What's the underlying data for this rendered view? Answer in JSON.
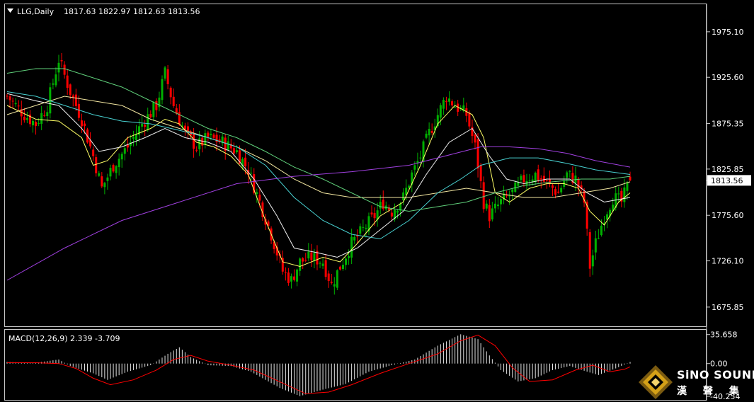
{
  "header": {
    "symbol": "LLG,Daily",
    "ohlc": "1817.63 1822.97 1812.63 1813.56"
  },
  "macd_panel": {
    "label": "MACD(12,26,9) 2.339 -3.709"
  },
  "logo": {
    "brand": "SiNO SOUND",
    "chinese": "漢 聲 集 團"
  },
  "colors": {
    "background": "#000000",
    "frame": "#c8c8c8",
    "bull_candle": "#00b000",
    "bear_candle": "#ff0000",
    "price_tag_bg": "#ffffff",
    "ma_yellow": "#ffff66",
    "ma_khaki": "#f2e6a0",
    "ma_white": "#f0f0f0",
    "ma_cyan": "#48d1d1",
    "ma_green": "#5fcf7a",
    "ma_purple": "#a040e0",
    "macd_hist": "#e6e6e6",
    "macd_signal": "#ff0000",
    "logo_gold": "#d4a017"
  },
  "chart_data": [
    {
      "type": "candlestick",
      "title": "LLG,Daily",
      "ylim": [
        1655,
        2005
      ],
      "yticks": [
        1675.85,
        1726.1,
        1775.6,
        1825.85,
        1875.35,
        1925.6,
        1975.1
      ],
      "ytick_labels": [
        "1675.85",
        "1726.10",
        "1775.60",
        "1825.85",
        "1875.35",
        "1925.60",
        "1975.10"
      ],
      "current_price": 1813.56,
      "current_price_label": "1813.56",
      "last_bar": {
        "open": 1817.63,
        "high": 1822.97,
        "low": 1812.63,
        "close": 1813.56
      },
      "close_path": [
        [
          0,
          1905
        ],
        [
          6,
          1885
        ],
        [
          10,
          1875
        ],
        [
          14,
          1895
        ],
        [
          18,
          1945
        ],
        [
          22,
          1910
        ],
        [
          26,
          1880
        ],
        [
          30,
          1840
        ],
        [
          33,
          1805
        ],
        [
          37,
          1830
        ],
        [
          42,
          1850
        ],
        [
          47,
          1875
        ],
        [
          52,
          1895
        ],
        [
          55,
          1930
        ],
        [
          58,
          1895
        ],
        [
          62,
          1865
        ],
        [
          66,
          1850
        ],
        [
          70,
          1860
        ],
        [
          75,
          1855
        ],
        [
          80,
          1845
        ],
        [
          84,
          1825
        ],
        [
          88,
          1790
        ],
        [
          92,
          1755
        ],
        [
          96,
          1715
        ],
        [
          99,
          1705
        ],
        [
          102,
          1725
        ],
        [
          106,
          1730
        ],
        [
          110,
          1725
        ],
        [
          113,
          1700
        ],
        [
          116,
          1720
        ],
        [
          120,
          1745
        ],
        [
          124,
          1760
        ],
        [
          128,
          1775
        ],
        [
          131,
          1790
        ],
        [
          134,
          1780
        ],
        [
          138,
          1795
        ],
        [
          141,
          1820
        ],
        [
          144,
          1840
        ],
        [
          147,
          1865
        ],
        [
          150,
          1885
        ],
        [
          153,
          1905
        ],
        [
          156,
          1895
        ],
        [
          160,
          1885
        ],
        [
          163,
          1850
        ],
        [
          166,
          1790
        ],
        [
          168,
          1775
        ],
        [
          172,
          1790
        ],
        [
          176,
          1800
        ],
        [
          180,
          1815
        ],
        [
          184,
          1820
        ],
        [
          188,
          1810
        ],
        [
          192,
          1800
        ],
        [
          195,
          1820
        ],
        [
          198,
          1815
        ],
        [
          201,
          1790
        ],
        [
          203,
          1720
        ],
        [
          205,
          1745
        ],
        [
          208,
          1775
        ],
        [
          211,
          1795
        ],
        [
          214,
          1790
        ],
        [
          217,
          1814
        ]
      ],
      "moving_averages": [
        {
          "color_key": "ma_yellow",
          "points": [
            [
              0,
              1895
            ],
            [
              10,
              1880
            ],
            [
              18,
              1878
            ],
            [
              26,
              1860
            ],
            [
              30,
              1830
            ],
            [
              35,
              1835
            ],
            [
              42,
              1860
            ],
            [
              50,
              1870
            ],
            [
              55,
              1880
            ],
            [
              60,
              1875
            ],
            [
              66,
              1855
            ],
            [
              72,
              1850
            ],
            [
              78,
              1840
            ],
            [
              84,
              1820
            ],
            [
              90,
              1770
            ],
            [
              96,
              1725
            ],
            [
              102,
              1720
            ],
            [
              110,
              1730
            ],
            [
              116,
              1725
            ],
            [
              122,
              1745
            ],
            [
              130,
              1775
            ],
            [
              138,
              1790
            ],
            [
              144,
              1830
            ],
            [
              150,
              1875
            ],
            [
              156,
              1895
            ],
            [
              162,
              1885
            ],
            [
              166,
              1860
            ],
            [
              170,
              1800
            ],
            [
              175,
              1790
            ],
            [
              182,
              1805
            ],
            [
              188,
              1810
            ],
            [
              194,
              1810
            ],
            [
              199,
              1805
            ],
            [
              203,
              1780
            ],
            [
              208,
              1765
            ],
            [
              213,
              1790
            ],
            [
              217,
              1800
            ]
          ]
        },
        {
          "color_key": "ma_white",
          "points": [
            [
              0,
              1908
            ],
            [
              10,
              1900
            ],
            [
              18,
              1895
            ],
            [
              26,
              1870
            ],
            [
              32,
              1845
            ],
            [
              40,
              1850
            ],
            [
              48,
              1860
            ],
            [
              55,
              1870
            ],
            [
              62,
              1860
            ],
            [
              70,
              1855
            ],
            [
              78,
              1845
            ],
            [
              86,
              1815
            ],
            [
              94,
              1775
            ],
            [
              100,
              1740
            ],
            [
              108,
              1735
            ],
            [
              115,
              1730
            ],
            [
              122,
              1740
            ],
            [
              130,
              1760
            ],
            [
              138,
              1780
            ],
            [
              146,
              1820
            ],
            [
              154,
              1855
            ],
            [
              162,
              1870
            ],
            [
              168,
              1840
            ],
            [
              174,
              1815
            ],
            [
              180,
              1810
            ],
            [
              188,
              1815
            ],
            [
              196,
              1815
            ],
            [
              202,
              1800
            ],
            [
              208,
              1790
            ],
            [
              217,
              1795
            ]
          ]
        },
        {
          "color_key": "ma_khaki",
          "points": [
            [
              0,
              1885
            ],
            [
              10,
              1895
            ],
            [
              20,
              1905
            ],
            [
              30,
              1900
            ],
            [
              40,
              1895
            ],
            [
              50,
              1880
            ],
            [
              60,
              1870
            ],
            [
              70,
              1860
            ],
            [
              80,
              1850
            ],
            [
              90,
              1835
            ],
            [
              100,
              1815
            ],
            [
              110,
              1800
            ],
            [
              120,
              1795
            ],
            [
              130,
              1795
            ],
            [
              140,
              1795
            ],
            [
              150,
              1800
            ],
            [
              160,
              1805
            ],
            [
              170,
              1800
            ],
            [
              180,
              1795
            ],
            [
              190,
              1795
            ],
            [
              200,
              1800
            ],
            [
              210,
              1805
            ],
            [
              217,
              1812
            ]
          ]
        },
        {
          "color_key": "ma_cyan",
          "points": [
            [
              0,
              1910
            ],
            [
              10,
              1905
            ],
            [
              20,
              1895
            ],
            [
              30,
              1885
            ],
            [
              40,
              1878
            ],
            [
              50,
              1875
            ],
            [
              60,
              1868
            ],
            [
              70,
              1860
            ],
            [
              80,
              1850
            ],
            [
              90,
              1830
            ],
            [
              100,
              1795
            ],
            [
              110,
              1770
            ],
            [
              120,
              1755
            ],
            [
              130,
              1750
            ],
            [
              140,
              1770
            ],
            [
              150,
              1800
            ],
            [
              158,
              1815
            ],
            [
              165,
              1830
            ],
            [
              175,
              1838
            ],
            [
              185,
              1838
            ],
            [
              195,
              1832
            ],
            [
              205,
              1825
            ],
            [
              217,
              1820
            ]
          ]
        },
        {
          "color_key": "ma_green",
          "points": [
            [
              0,
              1930
            ],
            [
              10,
              1935
            ],
            [
              20,
              1935
            ],
            [
              30,
              1925
            ],
            [
              40,
              1915
            ],
            [
              50,
              1900
            ],
            [
              60,
              1885
            ],
            [
              70,
              1870
            ],
            [
              80,
              1860
            ],
            [
              90,
              1845
            ],
            [
              100,
              1828
            ],
            [
              110,
              1815
            ],
            [
              120,
              1800
            ],
            [
              130,
              1785
            ],
            [
              140,
              1780
            ],
            [
              150,
              1785
            ],
            [
              160,
              1790
            ],
            [
              170,
              1800
            ],
            [
              180,
              1808
            ],
            [
              190,
              1812
            ],
            [
              200,
              1815
            ],
            [
              210,
              1815
            ],
            [
              217,
              1818
            ]
          ]
        },
        {
          "color_key": "ma_purple",
          "points": [
            [
              0,
              1705
            ],
            [
              20,
              1740
            ],
            [
              40,
              1770
            ],
            [
              60,
              1790
            ],
            [
              80,
              1810
            ],
            [
              100,
              1818
            ],
            [
              120,
              1823
            ],
            [
              140,
              1830
            ],
            [
              155,
              1842
            ],
            [
              165,
              1850
            ],
            [
              175,
              1850
            ],
            [
              185,
              1848
            ],
            [
              195,
              1843
            ],
            [
              205,
              1835
            ],
            [
              217,
              1828
            ]
          ]
        }
      ]
    },
    {
      "type": "macd",
      "title": "MACD(12,26,9)",
      "values": {
        "macd": 2.339,
        "signal": -3.709
      },
      "ylim": [
        -42,
        38
      ],
      "yticks": [
        35.658,
        0.0,
        -40.254
      ],
      "ytick_labels": [
        "35.658",
        "0.00",
        "-40.254"
      ],
      "histogram_path": [
        [
          0,
          2
        ],
        [
          10,
          1
        ],
        [
          18,
          5
        ],
        [
          22,
          -3
        ],
        [
          30,
          -12
        ],
        [
          35,
          -20
        ],
        [
          42,
          -10
        ],
        [
          50,
          -2
        ],
        [
          56,
          12
        ],
        [
          60,
          20
        ],
        [
          64,
          8
        ],
        [
          70,
          -2
        ],
        [
          78,
          -3
        ],
        [
          85,
          -10
        ],
        [
          95,
          -30
        ],
        [
          102,
          -40
        ],
        [
          110,
          -32
        ],
        [
          118,
          -25
        ],
        [
          126,
          -10
        ],
        [
          134,
          -2
        ],
        [
          142,
          5
        ],
        [
          150,
          22
        ],
        [
          158,
          36
        ],
        [
          164,
          30
        ],
        [
          168,
          10
        ],
        [
          172,
          -8
        ],
        [
          178,
          -22
        ],
        [
          184,
          -18
        ],
        [
          190,
          -8
        ],
        [
          196,
          -3
        ],
        [
          202,
          -10
        ],
        [
          206,
          -14
        ],
        [
          212,
          -6
        ],
        [
          217,
          2
        ]
      ],
      "signal_path": [
        [
          0,
          1
        ],
        [
          10,
          1
        ],
        [
          18,
          0
        ],
        [
          24,
          -6
        ],
        [
          30,
          -18
        ],
        [
          36,
          -26
        ],
        [
          44,
          -20
        ],
        [
          52,
          -8
        ],
        [
          58,
          5
        ],
        [
          64,
          10
        ],
        [
          70,
          3
        ],
        [
          78,
          -2
        ],
        [
          86,
          -8
        ],
        [
          96,
          -24
        ],
        [
          104,
          -37
        ],
        [
          112,
          -35
        ],
        [
          120,
          -26
        ],
        [
          130,
          -12
        ],
        [
          140,
          0
        ],
        [
          150,
          12
        ],
        [
          158,
          28
        ],
        [
          164,
          35
        ],
        [
          170,
          22
        ],
        [
          176,
          -5
        ],
        [
          182,
          -22
        ],
        [
          190,
          -20
        ],
        [
          198,
          -8
        ],
        [
          204,
          -2
        ],
        [
          210,
          -10
        ],
        [
          215,
          -7
        ],
        [
          217,
          -4
        ]
      ]
    }
  ]
}
